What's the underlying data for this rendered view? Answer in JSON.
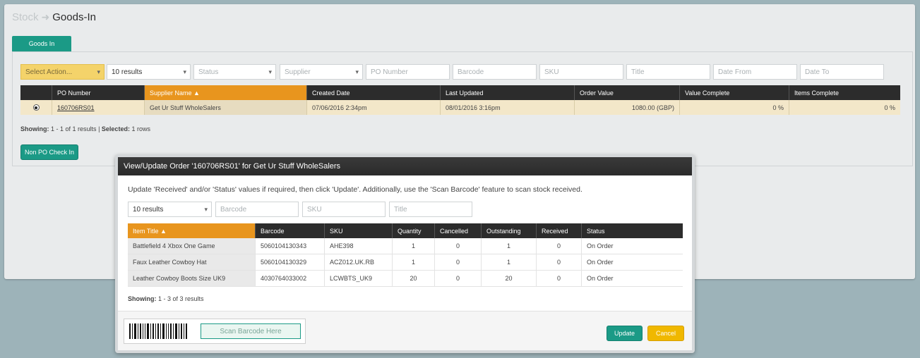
{
  "breadcrumb": {
    "parent": "Stock",
    "current": "Goods-In"
  },
  "tab": {
    "label": "Goods In"
  },
  "filters": {
    "action": "Select Action...",
    "results": "10 results",
    "status": "Status",
    "supplier": "Supplier",
    "po_number": "PO Number",
    "barcode": "Barcode",
    "sku": "SKU",
    "title": "Title",
    "date_from": "Date From",
    "date_to": "Date To"
  },
  "main_table": {
    "headers": [
      "PO Number",
      "Supplier Name ▲",
      "Created Date",
      "Last Updated",
      "Order Value",
      "Value Complete",
      "Items Complete"
    ],
    "rows": [
      {
        "po": "160706RS01",
        "supplier": "Get Ur Stuff WholeSalers",
        "created": "07/06/2016 2:34pm",
        "updated": "08/01/2016 3:16pm",
        "value": "1080.00 (GBP)",
        "value_complete": "0 %",
        "items_complete": "0 %"
      }
    ]
  },
  "showing": {
    "label": "Showing:",
    "range": "1 - 1 of 1 results",
    "sep": "|",
    "selected_label": "Selected:",
    "selected": "1 rows"
  },
  "non_po_button": "Non PO Check In",
  "modal": {
    "title": "View/Update Order '160706RS01' for Get Ur Stuff WholeSalers",
    "instructions": "Update 'Received' and/or 'Status' values if required, then click 'Update'. Additionally, use the 'Scan Barcode' feature to scan stock received.",
    "filters": {
      "results": "10 results",
      "barcode": "Barcode",
      "sku": "SKU",
      "title": "Title"
    },
    "headers": [
      "Item Title ▲",
      "Barcode",
      "SKU",
      "Quantity",
      "Cancelled",
      "Outstanding",
      "Received",
      "Status"
    ],
    "rows": [
      [
        "Battlefield 4 Xbox One Game",
        "5060104130343",
        "AHE398",
        "1",
        "0",
        "1",
        "0",
        "On Order"
      ],
      [
        "Faux Leather Cowboy Hat",
        "5060104130329",
        "ACZ012.UK.RB",
        "1",
        "0",
        "1",
        "0",
        "On Order"
      ],
      [
        "Leather Cowboy Boots Size UK9",
        "4030764033002",
        "LCWBTS_UK9",
        "20",
        "0",
        "20",
        "0",
        "On Order"
      ]
    ],
    "showing_label": "Showing:",
    "showing": "1 - 3 of 3 results",
    "scan_placeholder": "Scan Barcode Here",
    "update": "Update",
    "cancel": "Cancel"
  }
}
